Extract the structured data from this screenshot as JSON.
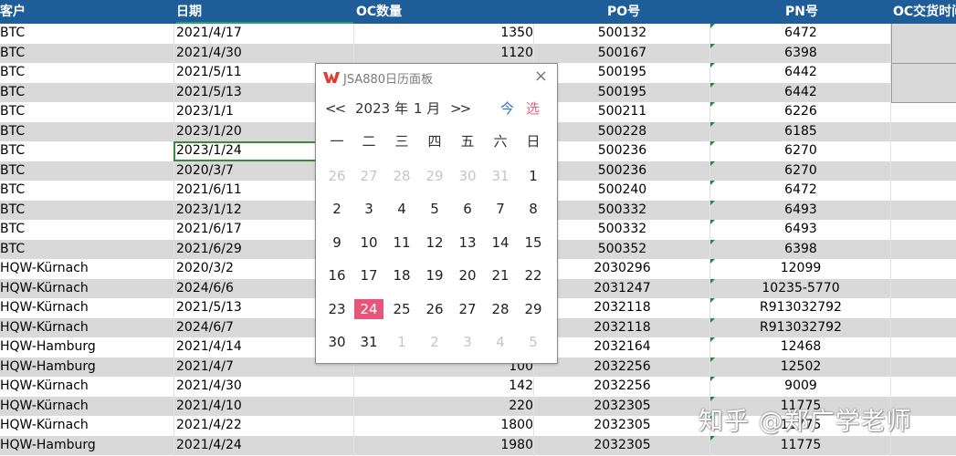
{
  "headers": {
    "customer": "客户",
    "date": "日期",
    "qty": "OC数量",
    "po": "PO号",
    "pn": "PN号",
    "oc_date": "OC交货时间"
  },
  "rows": [
    {
      "customer": "BTC",
      "date": "2021/4/17",
      "qty": "1350",
      "po": "500132",
      "pn": "6472"
    },
    {
      "customer": "BTC",
      "date": "2021/4/30",
      "qty": "1120",
      "po": "500167",
      "pn": "6398"
    },
    {
      "customer": "BTC",
      "date": "2021/5/11",
      "qty": "",
      "po": "500195",
      "pn": "6442"
    },
    {
      "customer": "BTC",
      "date": "2021/5/13",
      "qty": "",
      "po": "500195",
      "pn": "6442"
    },
    {
      "customer": "BTC",
      "date": "2023/1/1",
      "qty": "",
      "po": "500211",
      "pn": "6226"
    },
    {
      "customer": "BTC",
      "date": "2023/1/20",
      "qty": "",
      "po": "500228",
      "pn": "6185"
    },
    {
      "customer": "BTC",
      "date": "2023/1/24",
      "qty": "",
      "po": "500236",
      "pn": "6270"
    },
    {
      "customer": "BTC",
      "date": "2020/3/7",
      "qty": "",
      "po": "500236",
      "pn": "6270"
    },
    {
      "customer": "BTC",
      "date": "2021/6/11",
      "qty": "",
      "po": "500240",
      "pn": "6472"
    },
    {
      "customer": "BTC",
      "date": "2023/1/12",
      "qty": "",
      "po": "500332",
      "pn": "6493"
    },
    {
      "customer": "BTC",
      "date": "2021/6/17",
      "qty": "",
      "po": "500332",
      "pn": "6493"
    },
    {
      "customer": "BTC",
      "date": "2021/6/29",
      "qty": "",
      "po": "500352",
      "pn": "6398"
    },
    {
      "customer": "HQW-Kürnach",
      "date": "2020/3/2",
      "qty": "",
      "po": "2030296",
      "pn": "12099"
    },
    {
      "customer": "HQW-Kürnach",
      "date": "2024/6/6",
      "qty": "",
      "po": "2031247",
      "pn": "10235-5770"
    },
    {
      "customer": "HQW-Kürnach",
      "date": "2021/5/13",
      "qty": "",
      "po": "2032118",
      "pn": "R913032792"
    },
    {
      "customer": "HQW-Kürnach",
      "date": "2024/6/7",
      "qty": "",
      "po": "2032118",
      "pn": "R913032792"
    },
    {
      "customer": "HQW-Hamburg",
      "date": "2021/4/14",
      "qty": "",
      "po": "2032164",
      "pn": "12468"
    },
    {
      "customer": "HQW-Hamburg",
      "date": "2021/4/7",
      "qty": "100",
      "po": "2032256",
      "pn": "12502"
    },
    {
      "customer": "HQW-Kürnach",
      "date": "2021/4/30",
      "qty": "142",
      "po": "2032256",
      "pn": "9009"
    },
    {
      "customer": "HQW-Kürnach",
      "date": "2021/4/10",
      "qty": "220",
      "po": "2032305",
      "pn": "11775"
    },
    {
      "customer": "HQW-Kürnach",
      "date": "2021/4/22",
      "qty": "1800",
      "po": "2032305",
      "pn": "11775"
    },
    {
      "customer": "HQW-Hamburg",
      "date": "2021/4/24",
      "qty": "1980",
      "po": "2032305",
      "pn": "11775"
    }
  ],
  "calendar": {
    "title": "JSA880日历面板",
    "close": "×",
    "prev": "<<",
    "next": ">>",
    "year_label": "2023 年",
    "month_label": "1 月",
    "today_btn": "今",
    "select_btn": "选",
    "weekdays": [
      "一",
      "二",
      "三",
      "四",
      "五",
      "六",
      "日"
    ],
    "weeks": [
      [
        {
          "d": "26",
          "o": true
        },
        {
          "d": "27",
          "o": true
        },
        {
          "d": "28",
          "o": true
        },
        {
          "d": "29",
          "o": true
        },
        {
          "d": "30",
          "o": true
        },
        {
          "d": "31",
          "o": true
        },
        {
          "d": "1"
        }
      ],
      [
        {
          "d": "2"
        },
        {
          "d": "3"
        },
        {
          "d": "4"
        },
        {
          "d": "5"
        },
        {
          "d": "6"
        },
        {
          "d": "7"
        },
        {
          "d": "8"
        }
      ],
      [
        {
          "d": "9"
        },
        {
          "d": "10"
        },
        {
          "d": "11"
        },
        {
          "d": "12"
        },
        {
          "d": "13"
        },
        {
          "d": "14"
        },
        {
          "d": "15"
        }
      ],
      [
        {
          "d": "16"
        },
        {
          "d": "17"
        },
        {
          "d": "18"
        },
        {
          "d": "19"
        },
        {
          "d": "20"
        },
        {
          "d": "21"
        },
        {
          "d": "22"
        }
      ],
      [
        {
          "d": "23"
        },
        {
          "d": "24",
          "t": true
        },
        {
          "d": "25"
        },
        {
          "d": "26"
        },
        {
          "d": "27"
        },
        {
          "d": "28"
        },
        {
          "d": "29"
        }
      ],
      [
        {
          "d": "30"
        },
        {
          "d": "31"
        },
        {
          "d": "1",
          "o": true
        },
        {
          "d": "2",
          "o": true
        },
        {
          "d": "3",
          "o": true
        },
        {
          "d": "4",
          "o": true
        },
        {
          "d": "5",
          "o": true
        }
      ]
    ],
    "logo_icon": "wps-logo-icon"
  },
  "watermark": "知乎 @郑广学老师",
  "colors": {
    "header_bg": "#1f5d99",
    "alt_row": "#d9d9d9",
    "today_bg": "#e8557a",
    "today_btn": "#2c6fd6",
    "select_btn": "#e06680",
    "selection_border": "#3a8a3a"
  }
}
